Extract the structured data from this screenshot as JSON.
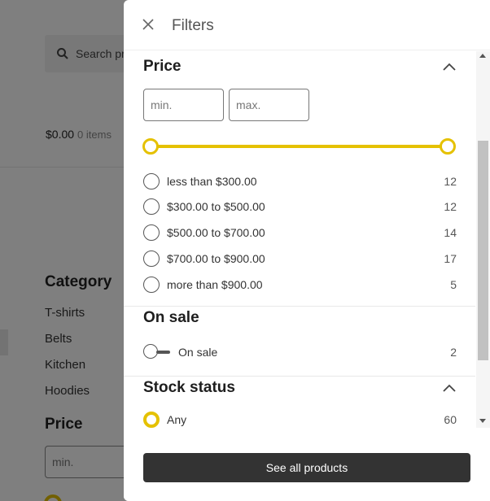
{
  "background": {
    "search_placeholder": "Search pro",
    "cart_total": "$0.00",
    "cart_items": "0 items",
    "category_title": "Category",
    "categories": [
      "T-shirts",
      "Belts",
      "Kitchen",
      "Hoodies"
    ],
    "price_title": "Price",
    "min_placeholder": "min."
  },
  "drawer": {
    "title": "Filters",
    "price": {
      "title": "Price",
      "min_placeholder": "min.",
      "max_placeholder": "max.",
      "options": [
        {
          "label": "less than $300.00",
          "count": "12"
        },
        {
          "label": "$300.00 to $500.00",
          "count": "12"
        },
        {
          "label": "$500.00 to $700.00",
          "count": "14"
        },
        {
          "label": "$700.00 to $900.00",
          "count": "17"
        },
        {
          "label": "more than $900.00",
          "count": "5"
        }
      ]
    },
    "on_sale": {
      "title": "On sale",
      "label": "On sale",
      "count": "2"
    },
    "stock": {
      "title": "Stock status",
      "options": [
        {
          "label": "Any",
          "count": "60",
          "selected": true
        }
      ]
    },
    "see_all_label": "See all products"
  },
  "colors": {
    "accent": "#e5c100",
    "button": "#333333"
  }
}
